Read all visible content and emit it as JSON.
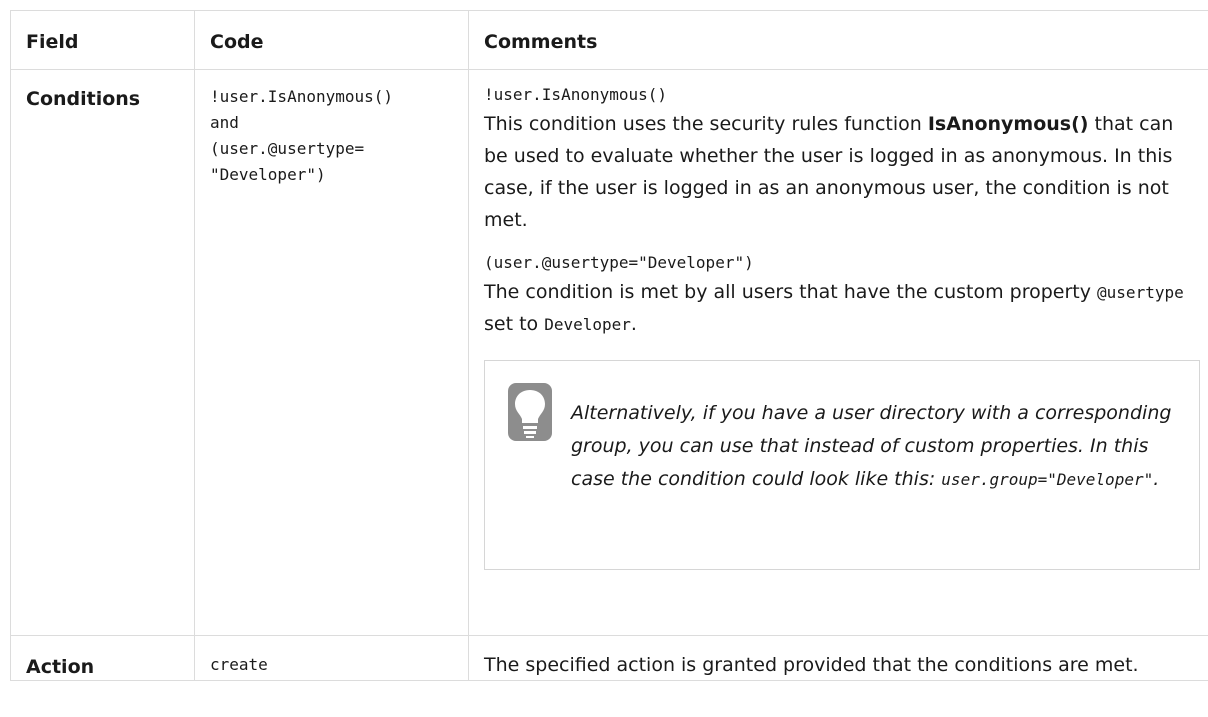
{
  "table": {
    "headers": {
      "field": "Field",
      "code": "Code",
      "comments": "Comments"
    },
    "rows": [
      {
        "field": "Conditions",
        "code": "!user.IsAnonymous()\nand\n(user.@usertype=\n\"Developer\")",
        "comments": {
          "part1_code": "!user.IsAnonymous()",
          "part1_text_before": "This condition uses the security rules function ",
          "part1_bold": "IsAnonymous()",
          "part1_text_after": " that can be used to evaluate whether the user is logged in as anonymous. In this case, if the user is logged in as an anonymous user, the condition is not met.",
          "part2_code": "(user.@usertype=\"Developer\")",
          "part2_text_before": "The condition is met by all users that have the custom property ",
          "part2_code_inline_1": "@usertype",
          "part2_text_middle": " set to ",
          "part2_code_inline_2": "Developer",
          "part2_text_after": ".",
          "tip": {
            "icon": "lightbulb-icon",
            "text_before": "Alternatively, if you have a user directory with a corresponding group, you can use that instead of custom properties. In this case the condition could look like this: ",
            "code": "user.group=\"Developer\"",
            "text_after": "."
          }
        }
      },
      {
        "field": "Action",
        "code": "create",
        "comments": "The specified action is granted provided that the conditions are met."
      }
    ]
  }
}
